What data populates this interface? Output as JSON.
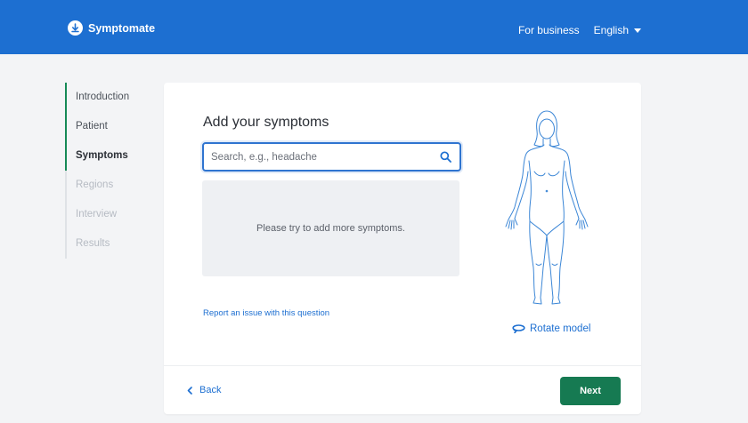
{
  "header": {
    "brand": "Symptomate",
    "for_business": "For business",
    "language": "English"
  },
  "steps": [
    {
      "label": "Introduction",
      "state": "done"
    },
    {
      "label": "Patient",
      "state": "done"
    },
    {
      "label": "Symptoms",
      "state": "active"
    },
    {
      "label": "Regions",
      "state": "pending"
    },
    {
      "label": "Interview",
      "state": "pending"
    },
    {
      "label": "Results",
      "state": "pending"
    }
  ],
  "main": {
    "title": "Add your symptoms",
    "search": {
      "placeholder": "Search, e.g., headache",
      "value": ""
    },
    "empty_message": "Please try to add more symptoms.",
    "report_link": "Report an issue with this question",
    "rotate_label": "Rotate model"
  },
  "footer": {
    "back_label": "Back",
    "next_label": "Next"
  },
  "colors": {
    "brand_blue": "#1d6fd1",
    "active_green": "#168a56",
    "next_button": "#167a52",
    "background": "#f3f4f6"
  }
}
